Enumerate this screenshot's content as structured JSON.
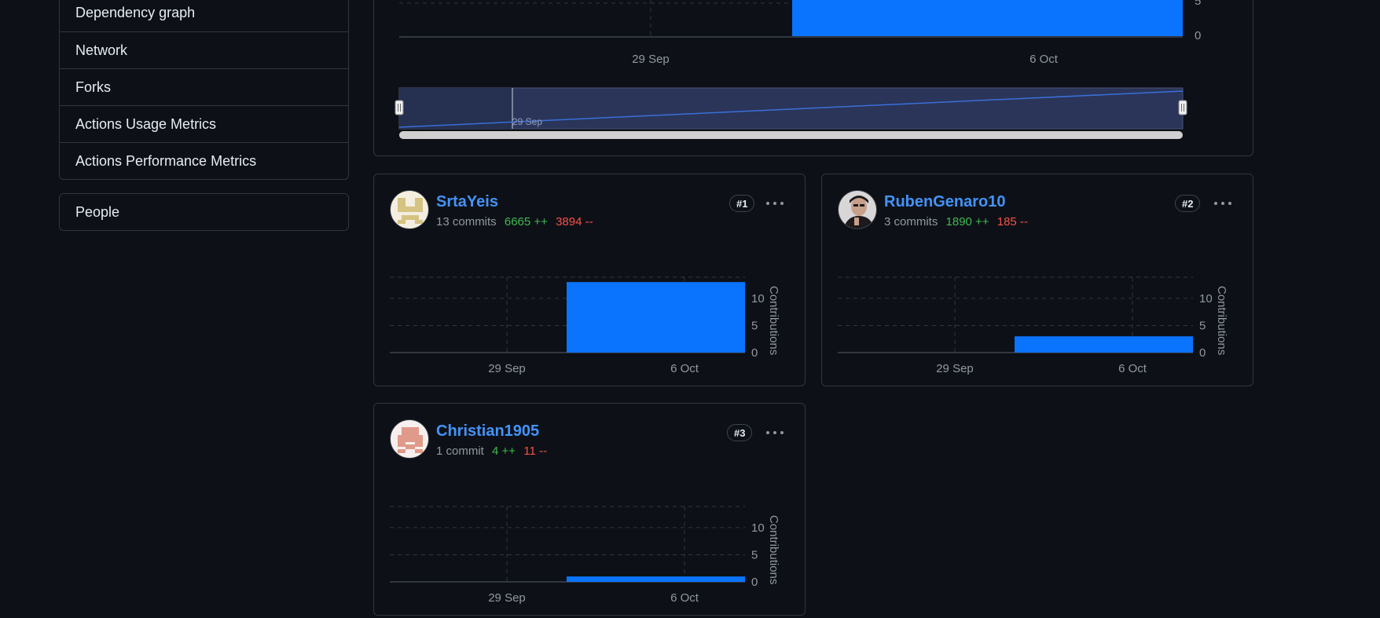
{
  "sidebar": {
    "items": [
      {
        "label": "Dependency graph"
      },
      {
        "label": "Network"
      },
      {
        "label": "Forks"
      },
      {
        "label": "Actions Usage Metrics"
      },
      {
        "label": "Actions Performance Metrics"
      }
    ],
    "people": {
      "label": "People"
    }
  },
  "overview": {
    "y_tick_partial": "5",
    "y_tick_zero": "0",
    "x_ticks": [
      "29 Sep",
      "6 Oct"
    ],
    "navigator_label": "29 Sep"
  },
  "contributors": [
    {
      "name": "SrtaYeis",
      "rank": "#1",
      "commits": "13 commits",
      "additions": "6665 ++",
      "deletions": "3894 --",
      "avatar_icon": "identicon-avatar-icon"
    },
    {
      "name": "RubenGenaro10",
      "rank": "#2",
      "commits": "3 commits",
      "additions": "1890 ++",
      "deletions": "185 --",
      "avatar_icon": "photo-avatar-icon"
    },
    {
      "name": "Christian1905",
      "rank": "#3",
      "commits": "1 commit",
      "additions": "4 ++",
      "deletions": "11 --",
      "avatar_icon": "identicon-avatar-icon"
    }
  ],
  "card_chart": {
    "y_axis_label": "Contributions",
    "y_ticks": [
      "10",
      "5",
      "0"
    ],
    "x_ticks": [
      "29 Sep",
      "6 Oct"
    ]
  },
  "chart_data": [
    {
      "type": "bar",
      "x_ticks": [
        "29 Sep",
        "6 Oct"
      ],
      "series": [
        {
          "values": [
            0,
            13
          ]
        }
      ],
      "note_values": "overview contributions, weekly buckets: before week of 6 Oct and week of 6 Oct"
    },
    {
      "type": "bar",
      "ylabel": "Contributions",
      "x_ticks": [
        "29 Sep",
        "6 Oct"
      ],
      "ylim": [
        0,
        14
      ],
      "series": [
        {
          "values": [
            0,
            13
          ]
        }
      ]
    },
    {
      "type": "bar",
      "ylabel": "Contributions",
      "x_ticks": [
        "29 Sep",
        "6 Oct"
      ],
      "ylim": [
        0,
        14
      ],
      "series": [
        {
          "values": [
            0,
            3
          ]
        }
      ]
    },
    {
      "type": "bar",
      "ylabel": "Contributions",
      "x_ticks": [
        "29 Sep",
        "6 Oct"
      ],
      "ylim": [
        0,
        14
      ],
      "series": [
        {
          "values": [
            0,
            1
          ]
        }
      ]
    }
  ],
  "colors": {
    "bar": "#0a74ff",
    "link": "#4493f8",
    "additions": "#3fb950",
    "deletions": "#f85149",
    "border": "#30363d",
    "background": "#0d1117"
  }
}
